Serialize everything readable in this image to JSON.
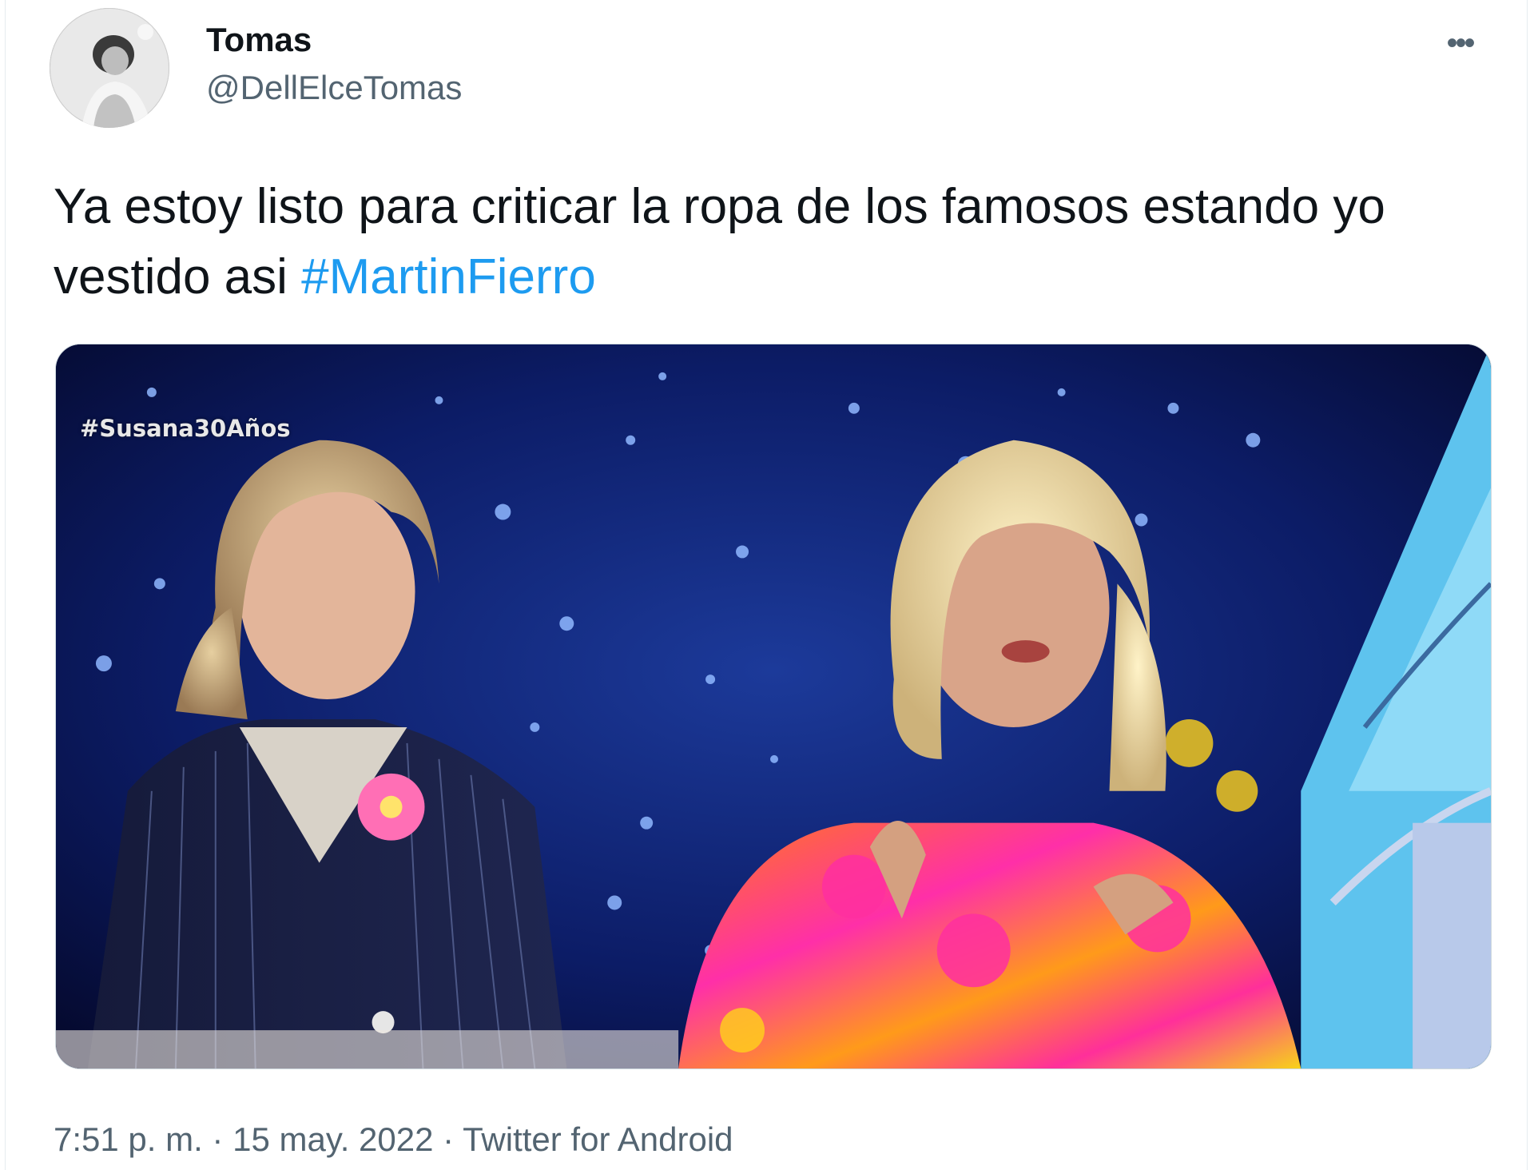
{
  "tweet": {
    "display_name": "Tomas",
    "handle": "@DellElceTomas",
    "text_before": "Ya estoy listo para criticar la ropa de los famosos estando yo vestido asi ",
    "hashtag": "#MartinFierro",
    "more_icon": "more-dots-icon",
    "more_label": "•••"
  },
  "media": {
    "overlay_caption": "#Susana30Años"
  },
  "meta": {
    "time": "7:51 p. m.",
    "separator": " · ",
    "date": "15 may. 2022",
    "source": "Twitter for Android"
  },
  "colors": {
    "link": "#1d9bf0",
    "secondary_text": "#536471",
    "primary_text": "#0f1419"
  }
}
